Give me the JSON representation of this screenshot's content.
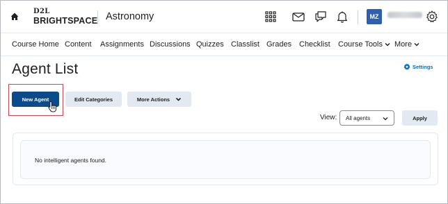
{
  "header": {
    "logo_top": "D2L",
    "logo_bottom": "BRIGHTSPACE",
    "course_title": "Astronomy",
    "avatar_initials": "MZ",
    "icons": [
      "home-icon",
      "waffle-grid-icon",
      "mail-icon",
      "chat-icon",
      "bell-icon",
      "gear-icon"
    ]
  },
  "nav": {
    "items": [
      {
        "label": "Course Home"
      },
      {
        "label": "Content"
      },
      {
        "label": "Assignments"
      },
      {
        "label": "Discussions"
      },
      {
        "label": "Quizzes"
      },
      {
        "label": "Classlist"
      },
      {
        "label": "Grades"
      },
      {
        "label": "Checklist"
      },
      {
        "label": "Course Tools"
      },
      {
        "label": "More"
      }
    ]
  },
  "page": {
    "title": "Agent List",
    "settings_label": "Settings",
    "new_agent_label": "New Agent",
    "edit_categories_label": "Edit Categories",
    "more_actions_label": "More Actions",
    "view_label": "View:",
    "view_selected": "All agents",
    "apply_label": "Apply",
    "empty_message": "No intelligent agents found."
  },
  "colors": {
    "primary_button": "#0b4a8b",
    "secondary_button": "#e3e9f1",
    "link": "#006fbf",
    "highlight": "#d9404b",
    "avatar": "#2f5fb3"
  }
}
